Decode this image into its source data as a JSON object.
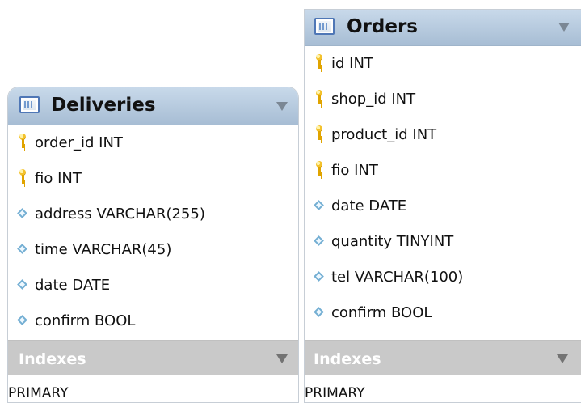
{
  "diagram": {
    "tables": [
      {
        "name": "Deliveries",
        "columns": [
          {
            "label": "order_id INT",
            "icon": "primary-key-icon"
          },
          {
            "label": "fio INT",
            "icon": "primary-key-icon"
          },
          {
            "label": "address VARCHAR(255)",
            "icon": "diamond-column-icon"
          },
          {
            "label": "time VARCHAR(45)",
            "icon": "diamond-column-icon"
          },
          {
            "label": "date DATE",
            "icon": "diamond-column-icon"
          },
          {
            "label": "confirm BOOL",
            "icon": "diamond-column-icon"
          }
        ],
        "indexes_label": "Indexes",
        "indexes": [
          "PRIMARY"
        ]
      },
      {
        "name": "Orders",
        "columns": [
          {
            "label": "id INT",
            "icon": "primary-key-icon"
          },
          {
            "label": "shop_id INT",
            "icon": "primary-key-icon"
          },
          {
            "label": "product_id INT",
            "icon": "primary-key-icon"
          },
          {
            "label": "fio INT",
            "icon": "primary-key-icon"
          },
          {
            "label": "date DATE",
            "icon": "diamond-column-icon"
          },
          {
            "label": "quantity TINYINT",
            "icon": "diamond-column-icon"
          },
          {
            "label": "tel VARCHAR(100)",
            "icon": "diamond-column-icon"
          },
          {
            "label": "confirm BOOL",
            "icon": "diamond-column-icon"
          }
        ],
        "indexes_label": "Indexes",
        "indexes": [
          "PRIMARY"
        ]
      }
    ],
    "colors": {
      "header_blue": "#a7bdd4",
      "index_gray": "#c9c9c9",
      "key_yellow": "#f3c22d",
      "column_diamond_blue": "#74afd3"
    }
  }
}
